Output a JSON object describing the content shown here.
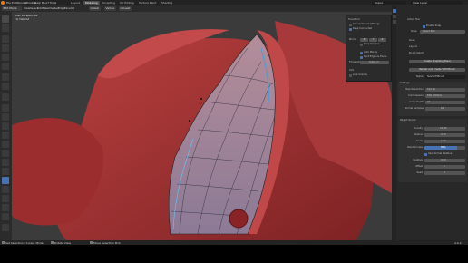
{
  "topbar": {
    "menus": [
      "File",
      "Edit",
      "Render",
      "Window",
      "Help",
      "Bsurf Tools"
    ],
    "workspaces": [
      "Layout",
      "Modeling",
      "Sculpting",
      "UV Editing",
      "Texture Paint",
      "Shading"
    ],
    "active_workspace": "Sculpting",
    "scene": "Scene",
    "view_layer": "View Layer"
  },
  "header": {
    "mode": "Edit Mode",
    "menus": [
      "View",
      "Select",
      "Add",
      "Mesh",
      "Vertex",
      "Edge",
      "Face",
      "UV"
    ],
    "transform": "Global",
    "snap_mode": "Vertex",
    "snap_target": "Closest",
    "select_mode": "Select Box"
  },
  "viewport": {
    "view_title": "User Perspective",
    "object_label": "(1) Helmet"
  },
  "retopo_popup": {
    "title": "Transform",
    "options": [
      {
        "label": "Connect Input (Wiring)",
        "checked": false
      },
      {
        "label": "Keep Connected",
        "checked": true
      },
      {
        "label": "Keep Original",
        "checked": false
      }
    ],
    "mirror_label": "Mirror",
    "mirror_axes": [
      "X",
      "Y",
      "Z"
    ],
    "auto_merge": "Auto Merge",
    "split_edges": "Split Edges & Faces",
    "threshold_label": "Threshold",
    "threshold_value": "0.001 m",
    "uvs_label": "UVs",
    "live_unwrap": "Live Unwrap"
  },
  "sidebar": {
    "tool_header": "Active Tool",
    "brush_label": "Snap",
    "brush_value": "Select Box",
    "options_label": "Snap",
    "enable_snap": "Enable Snap",
    "layout_label": "Layout",
    "brush_select": "Brush Select",
    "create_plane": "Create Sculpting Plane",
    "render_button": "Render and Create VDM Brush",
    "name_label": "Name",
    "name_value": "NewVDMBrush",
    "settings_header": "Settings",
    "settings_rows": [
      {
        "label": "Map Resolution",
        "value": "512 px"
      },
      {
        "label": "Compression",
        "value": "EXR (DWAA)"
      },
      {
        "label": "Color Depth",
        "value": "32"
      },
      {
        "label": "Normal Samples",
        "value": "64"
      }
    ],
    "sculpt_header": "Object Sculpt",
    "sculpt_rows": [
      {
        "label": "Density",
        "value": "10.00"
      },
      {
        "label": "Radius",
        "value": "0.35"
      },
      {
        "label": "Scale",
        "value": "1.00"
      },
      {
        "label": "Randomness",
        "value": "80%"
      }
    ],
    "use_normal": "Use Normal Relative",
    "extra_rows": [
      {
        "label": "Relative",
        "value": "0.50"
      },
      {
        "label": "Offset",
        "value": "0"
      },
      {
        "label": "Seed",
        "value": "0"
      }
    ]
  },
  "status": {
    "left": "Set Selection / Cursor Mode",
    "middle": "Rotate View",
    "right": "Move Selection Pick",
    "version": "4.0.2"
  },
  "colors": {
    "model": "#a33335",
    "accent": "#4772b3",
    "ui_bg": "#2b2b2b"
  }
}
